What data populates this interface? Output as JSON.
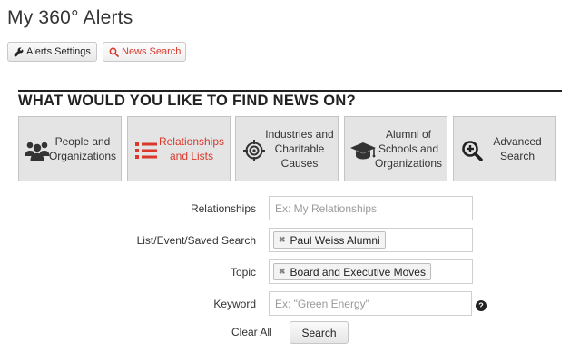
{
  "page": {
    "title": "My 360° Alerts"
  },
  "toolbar": {
    "alerts_settings_label": "Alerts Settings",
    "news_search_label": "News Search"
  },
  "section": {
    "heading": "WHAT WOULD YOU LIKE TO FIND NEWS ON?"
  },
  "categories": [
    {
      "label": "People and Organizations",
      "icon": "people-icon",
      "active": false
    },
    {
      "label": "Relationships and Lists",
      "icon": "list-icon",
      "active": true
    },
    {
      "label": "Industries and Charitable Causes",
      "icon": "target-icon",
      "active": false
    },
    {
      "label": "Alumni of Schools and Organizations",
      "icon": "graduation-cap-icon",
      "active": false
    },
    {
      "label": "Advanced Search",
      "icon": "zoom-in-icon",
      "active": false
    }
  ],
  "form": {
    "relationships": {
      "label": "Relationships",
      "placeholder": "Ex: My Relationships"
    },
    "list": {
      "label": "List/Event/Saved Search",
      "tag": "Paul Weiss Alumni"
    },
    "topic": {
      "label": "Topic",
      "tag": "Board and Executive Moves"
    },
    "keyword": {
      "label": "Keyword",
      "placeholder": "Ex: \"Green Energy\""
    },
    "clear_all": "Clear All",
    "search": "Search"
  },
  "colors": {
    "accent": "#d9382b",
    "tile_bg": "#e4e4e4",
    "rule": "#222222"
  }
}
